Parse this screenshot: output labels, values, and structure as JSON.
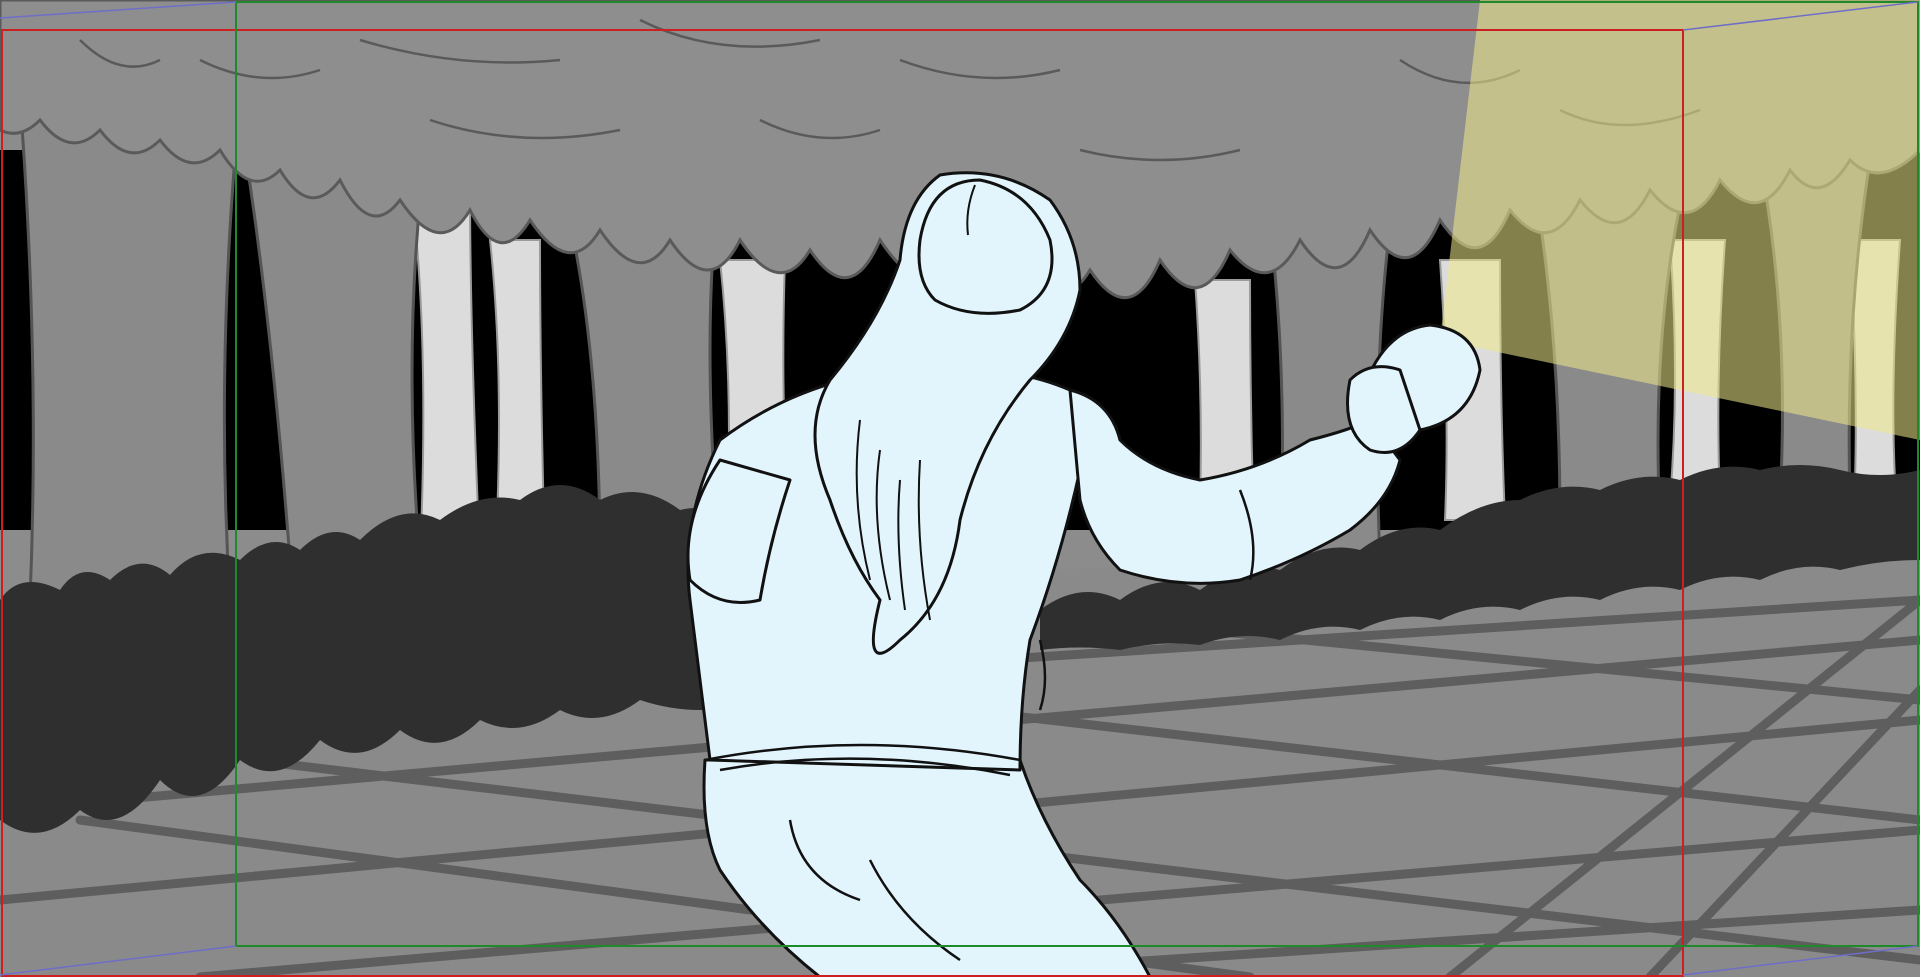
{
  "scene": {
    "kind": "storyboard-panel",
    "colors": {
      "sky_gap": "#000000",
      "canopy": "#8e8e8e",
      "trunk_dark": "#8a8a8a",
      "trunk_light": "#dcdcdc",
      "bush": "#2f2f2f",
      "ground": "#8a8a8a",
      "ground_lines": "#5e5e5e",
      "figure_fill": "#e2f4fc",
      "figure_stroke": "#111111",
      "flashlight_beam": "#f0ea8a",
      "safe_frame": "#cc1f1f",
      "title_safe_frame": "#1e8a2a",
      "camera_guide": "#6e6ec8"
    },
    "elements": {
      "background": "forest",
      "character": "girl-running-with-flashlight",
      "light": "flashlight-beam",
      "guides": [
        "safe-frame",
        "title-safe-frame",
        "camera-guide"
      ]
    }
  }
}
